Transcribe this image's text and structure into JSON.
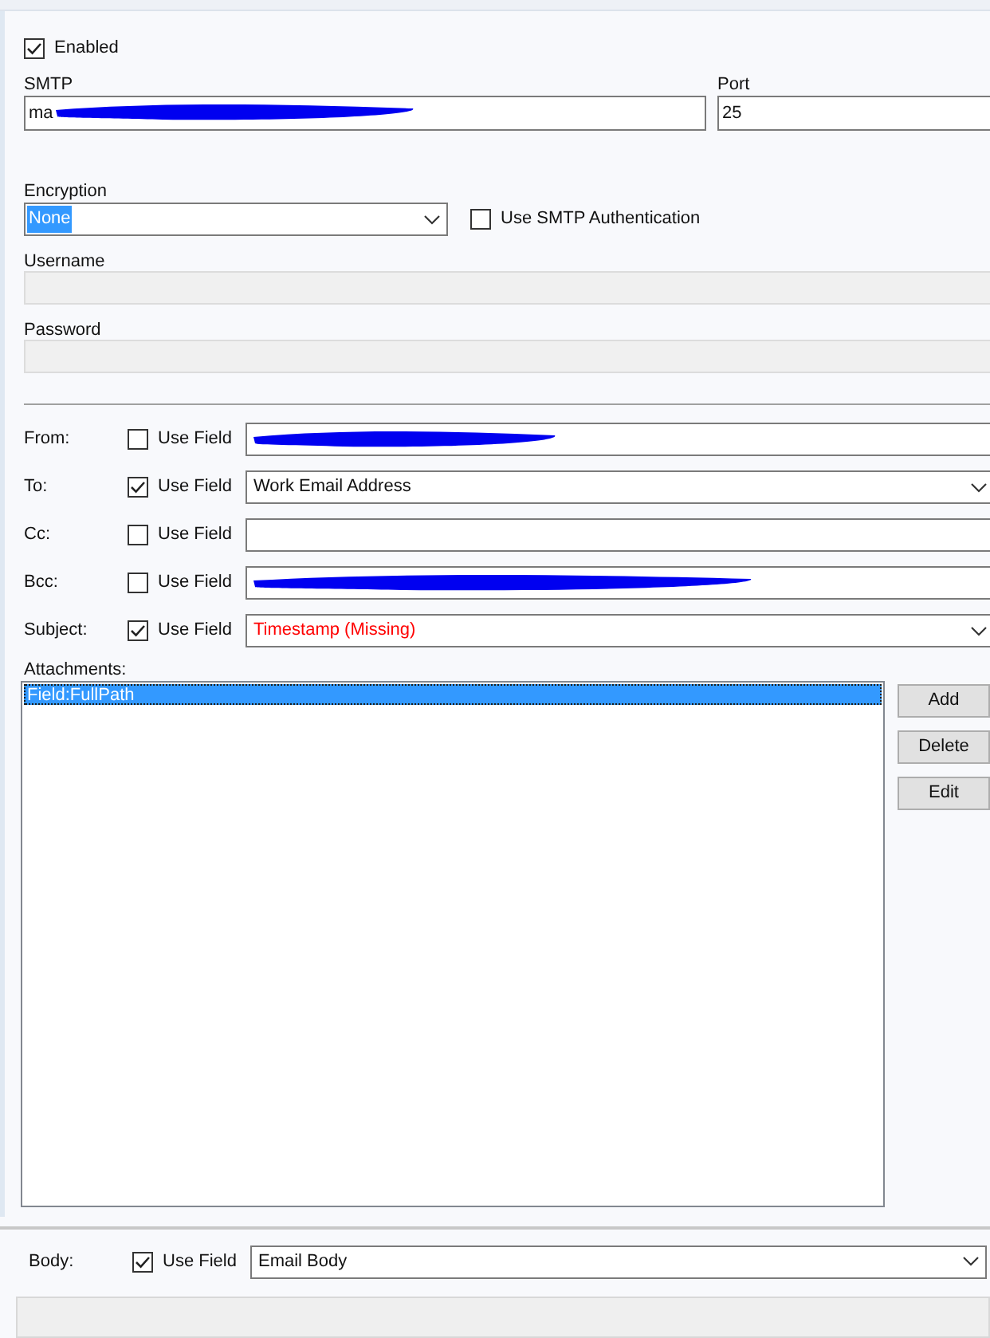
{
  "enabled": {
    "label": "Enabled",
    "checked": true
  },
  "smtp": {
    "label": "SMTP",
    "value": "ma",
    "redacted": true
  },
  "port": {
    "label": "Port",
    "value": "25"
  },
  "encryption": {
    "label": "Encryption",
    "value": "None"
  },
  "smtp_auth": {
    "label": "Use SMTP Authentication",
    "checked": false
  },
  "username": {
    "label": "Username",
    "disabled": true
  },
  "password": {
    "label": "Password",
    "disabled": true
  },
  "recipients": [
    {
      "label": "From:",
      "use_field_label": "Use Field",
      "checked": false,
      "kind": "text",
      "redacted": true
    },
    {
      "label": "To:",
      "use_field_label": "Use Field",
      "checked": true,
      "kind": "select",
      "value": "Work Email Address"
    },
    {
      "label": "Cc:",
      "use_field_label": "Use Field",
      "checked": false,
      "kind": "text"
    },
    {
      "label": "Bcc:",
      "use_field_label": "Use Field",
      "checked": false,
      "kind": "text",
      "redacted": true
    },
    {
      "label": "Subject:",
      "use_field_label": "Use Field",
      "checked": true,
      "kind": "select",
      "value": "Timestamp (Missing)",
      "error": true
    }
  ],
  "attachments": {
    "label": "Attachments:",
    "items": [
      {
        "label": "Field:FullPath",
        "selected": true
      }
    ],
    "buttons": [
      "Add",
      "Delete",
      "Edit"
    ]
  },
  "body": {
    "label": "Body:",
    "use_field_label": "Use Field",
    "checked": true,
    "kind": "select",
    "value": "Email Body"
  }
}
